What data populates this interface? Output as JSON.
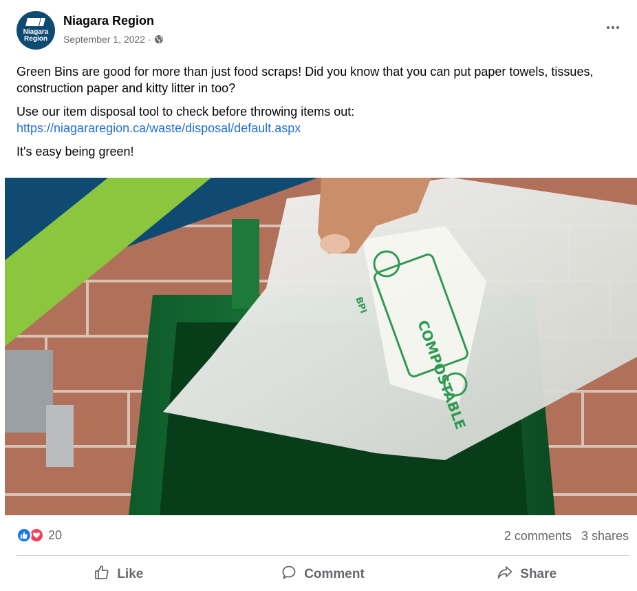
{
  "post": {
    "page_name": "Niagara Region",
    "date": "September 1, 2022",
    "separator": "·",
    "privacy_icon": "globe-icon",
    "avatar": {
      "line1": "Niagara",
      "line2": "Region",
      "bg_color": "#0f4a72"
    },
    "paragraphs": [
      "Green Bins are good for more than just food scraps! Did you know that you can put paper towels, tissues, construction paper and kitty litter in too?",
      "Use our item disposal tool to check before throwing items out:",
      "It's easy being green!"
    ],
    "link": "https://niagararegion.ca/waste/disposal/default.aspx",
    "link_color": "#216fdb",
    "image": {
      "bag_label": "COMPOSTABLE",
      "bag_mark": "BPI",
      "banner_colors": [
        "#0f4a72",
        "#8cc63f"
      ]
    }
  },
  "stats": {
    "reaction_icons": [
      "like-icon",
      "love-icon"
    ],
    "reaction_count": "20",
    "comments": "2 comments",
    "shares": "3 shares"
  },
  "actions": {
    "like": "Like",
    "comment": "Comment",
    "share": "Share"
  }
}
